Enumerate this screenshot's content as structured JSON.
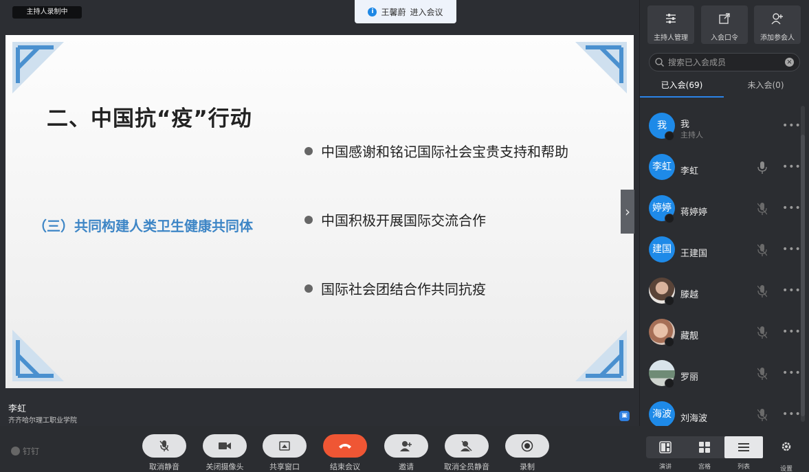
{
  "meeting": {
    "recording_badge": "主持人录制中",
    "toast": {
      "icon": "info-icon",
      "name": "王馨蔚",
      "text": "进入会议"
    },
    "slide": {
      "title": "二、中国抗“疫”行动",
      "subtitle": "（三）共同构建人类卫生健康共同体",
      "bullets": [
        "中国感谢和铭记国际社会宝贵支持和帮助",
        "中国积极开展国际交流合作",
        "国际社会团结合作共同抗疫"
      ],
      "accent_color": "#3e86c6"
    },
    "speaker": {
      "name": "李虹",
      "org": "齐齐哈尔理工职业学院"
    },
    "app_brand": "钉钉"
  },
  "toolbar": {
    "buttons": [
      {
        "label": "取消静音",
        "icon": "mic-off-icon"
      },
      {
        "label": "关闭摄像头",
        "icon": "camera-icon"
      },
      {
        "label": "共享窗口",
        "icon": "share-window-icon"
      },
      {
        "label": "结束会议",
        "icon": "hangup-icon"
      },
      {
        "label": "邀请",
        "icon": "invite-user-icon"
      },
      {
        "label": "取消全员静音",
        "icon": "mute-all-icon"
      },
      {
        "label": "录制",
        "icon": "record-icon"
      }
    ]
  },
  "panel": {
    "actions": [
      {
        "label": "主持人管理",
        "icon": "sliders-icon"
      },
      {
        "label": "入会口令",
        "icon": "external-link-icon"
      },
      {
        "label": "添加参会人",
        "icon": "add-user-icon"
      }
    ],
    "search_placeholder": "搜索已入会成员",
    "tabs": [
      {
        "label": "已入会(69)",
        "active": true
      },
      {
        "label": "未入会(0)",
        "active": false
      }
    ],
    "members": [
      {
        "avatar_text": "我",
        "name": "我",
        "role": "主持人",
        "mic": "none"
      },
      {
        "avatar_text": "李虹",
        "name": "李虹",
        "role": "",
        "mic": "on"
      },
      {
        "avatar_text": "婷婷",
        "name": "蒋婷婷",
        "role": "",
        "mic": "off"
      },
      {
        "avatar_text": "建国",
        "name": "王建国",
        "role": "",
        "mic": "off"
      },
      {
        "avatar_text": "",
        "name": "滕越",
        "role": "",
        "mic": "off"
      },
      {
        "avatar_text": "",
        "name": "藏靓",
        "role": "",
        "mic": "off"
      },
      {
        "avatar_text": "",
        "name": "罗丽",
        "role": "",
        "mic": "off"
      },
      {
        "avatar_text": "海波",
        "name": "刘海波",
        "role": "",
        "mic": "off"
      }
    ]
  },
  "view_modes": [
    {
      "label": "演讲",
      "icon": "speaker-layout-icon",
      "active": false
    },
    {
      "label": "宫格",
      "icon": "grid-layout-icon",
      "active": false
    },
    {
      "label": "列表",
      "icon": "list-layout-icon",
      "active": true
    }
  ],
  "settings_label": "设置"
}
